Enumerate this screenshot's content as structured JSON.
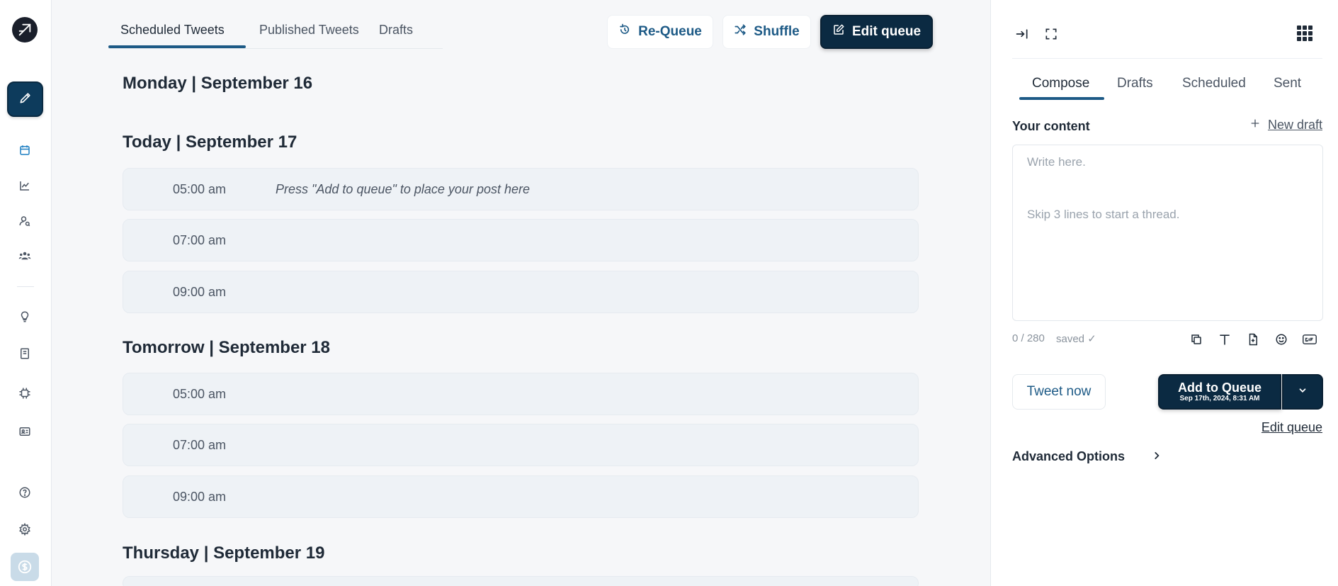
{
  "main": {
    "tabs": [
      {
        "label": "Scheduled Tweets"
      },
      {
        "label": "Published Tweets"
      },
      {
        "label": "Drafts"
      }
    ],
    "buttons": {
      "requeue": "Re-Queue",
      "shuffle": "Shuffle",
      "edit_queue": "Edit queue"
    },
    "days": [
      {
        "heading": "Monday | September 16",
        "slots": []
      },
      {
        "heading": "Today | September 17",
        "slots": [
          {
            "time": "05:00 am",
            "hint": "Press \"Add to queue\" to place your post here"
          },
          {
            "time": "07:00 am",
            "hint": ""
          },
          {
            "time": "09:00 am",
            "hint": ""
          }
        ]
      },
      {
        "heading": "Tomorrow | September 18",
        "slots": [
          {
            "time": "05:00 am",
            "hint": ""
          },
          {
            "time": "07:00 am",
            "hint": ""
          },
          {
            "time": "09:00 am",
            "hint": ""
          }
        ]
      },
      {
        "heading": "Thursday | September 19",
        "slots": []
      }
    ]
  },
  "panel": {
    "tabs": [
      {
        "label": "Compose"
      },
      {
        "label": "Drafts"
      },
      {
        "label": "Scheduled"
      },
      {
        "label": "Sent"
      }
    ],
    "your_content": "Your content",
    "new_draft": "New draft",
    "editor": {
      "placeholder_line1": "Write here.",
      "placeholder_line2": "Skip 3 lines to start a thread."
    },
    "counter": "0 / 280",
    "saved": "saved ✓",
    "tweet_now": "Tweet now",
    "add_to_queue": "Add to Queue",
    "add_to_queue_time": "Sep 17th, 2024, 8:31 AM",
    "edit_queue": "Edit queue",
    "advanced_options": "Advanced Options"
  },
  "colors": {
    "accent": "#1d5a86",
    "dark_button": "#0b2a42",
    "slot_bg": "#eef2f6"
  },
  "icons": {
    "rail": [
      "logo-icon",
      "compose-pencil-icon",
      "calendar-icon",
      "analytics-icon",
      "user-search-icon",
      "users-icon",
      "lightbulb-icon",
      "book-icon",
      "ai-chip-icon",
      "id-card-icon",
      "help-icon",
      "settings-icon",
      "coin-icon"
    ],
    "panel": [
      "collapse-panel-icon",
      "fullscreen-icon",
      "apps-grid-icon"
    ],
    "toolbar": [
      "copy-icon",
      "text-format-icon",
      "file-add-icon",
      "emoji-icon",
      "gif-icon"
    ]
  }
}
